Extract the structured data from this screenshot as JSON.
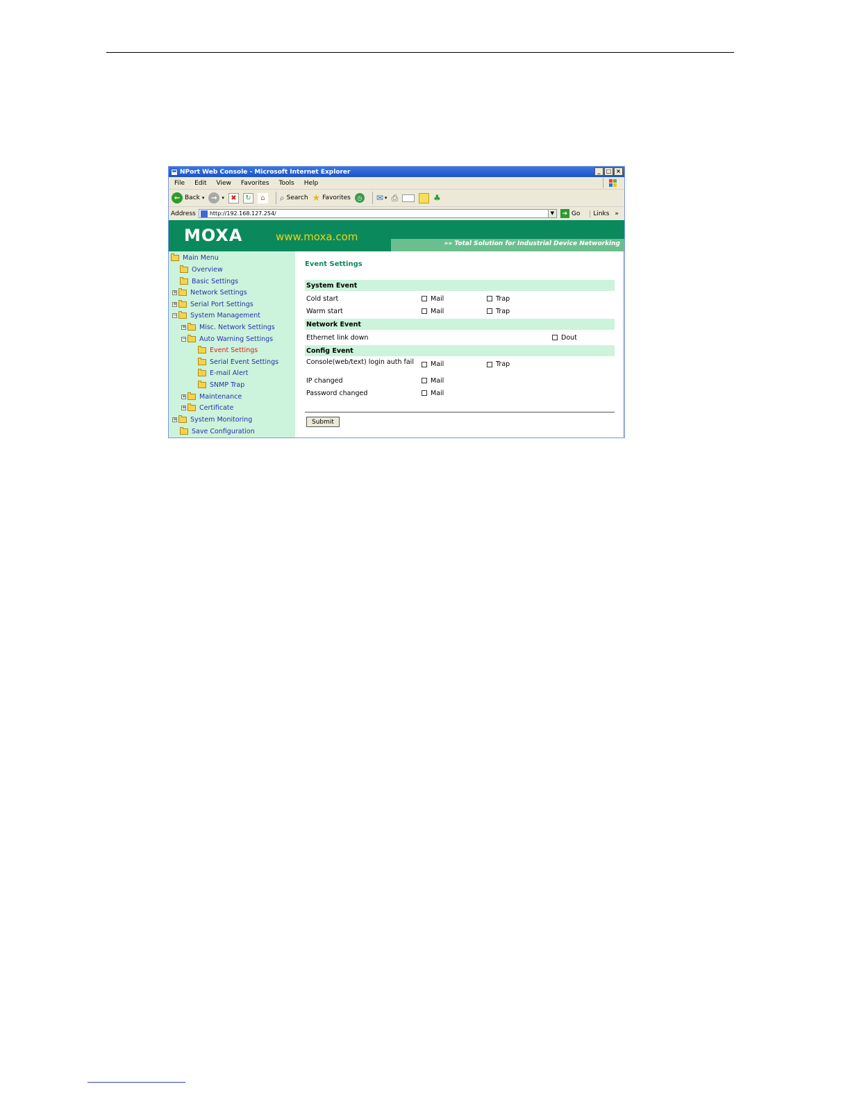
{
  "window": {
    "title": "NPort Web Console - Microsoft Internet Explorer",
    "buttons": [
      "_",
      "□",
      "×"
    ]
  },
  "menu": {
    "items": [
      {
        "label": "File"
      },
      {
        "label": "Edit"
      },
      {
        "label": "View"
      },
      {
        "label": "Favorites"
      },
      {
        "label": "Tools"
      },
      {
        "label": "Help"
      }
    ]
  },
  "toolbar": {
    "back_label": "Back",
    "search_label": "Search",
    "favorites_label": "Favorites"
  },
  "address": {
    "label": "Address",
    "url": "http://192.168.127.254/",
    "go_label": "Go",
    "links_label": "Links",
    "links_chevron": "»"
  },
  "banner": {
    "logo": "MOXA",
    "site": "www.moxa.com",
    "tagline": "Total Solution for Industrial Device Networking",
    "chevrons": "»»"
  },
  "sidebar": {
    "items": [
      {
        "label": "Main Menu"
      },
      {
        "label": "Overview"
      },
      {
        "label": "Basic Settings"
      },
      {
        "label": "Network Settings"
      },
      {
        "label": "Serial Port Settings"
      },
      {
        "label": "System Management"
      },
      {
        "label": "Misc. Network Settings"
      },
      {
        "label": "Auto Warning Settings"
      },
      {
        "label": "Event Settings"
      },
      {
        "label": "Serial Event Settings"
      },
      {
        "label": "E-mail Alert"
      },
      {
        "label": "SNMP Trap"
      },
      {
        "label": "Maintenance"
      },
      {
        "label": "Certificate"
      },
      {
        "label": "System Monitoring"
      },
      {
        "label": "Save Configuration"
      }
    ],
    "expander_plus": "+",
    "expander_minus": "−"
  },
  "main": {
    "title": "Event Settings",
    "sections": {
      "system": "System Event",
      "network": "Network Event",
      "config": "Config Event"
    },
    "rows": {
      "cold_start": "Cold start",
      "warm_start": "Warm start",
      "eth_link_down": "Ethernet link down",
      "console_login": "Console(web/text) login auth fail",
      "ip_changed": "IP changed",
      "password_changed": "Password changed"
    },
    "options": {
      "mail": "Mail",
      "trap": "Trap",
      "dout": "Dout"
    },
    "submit_label": "Submit"
  }
}
